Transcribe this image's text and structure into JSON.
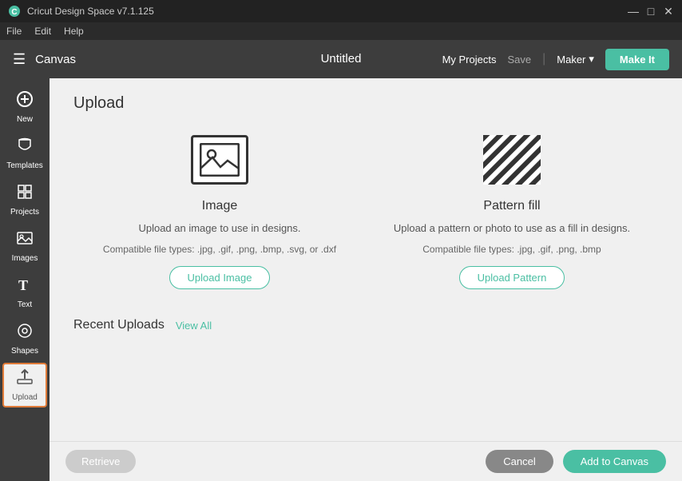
{
  "titlebar": {
    "title": "Cricut Design Space  v7.1.125",
    "minimize": "—",
    "maximize": "□",
    "close": "✕"
  },
  "menubar": {
    "items": [
      "File",
      "Edit",
      "Help"
    ]
  },
  "appbar": {
    "hamburger": "☰",
    "canvas_label": "Canvas",
    "project_title": "Untitled",
    "my_projects": "My Projects",
    "save": "Save",
    "separator": "|",
    "maker": "Maker",
    "maker_chevron": "▾",
    "make_it": "Make It"
  },
  "sidebar": {
    "items": [
      {
        "id": "new",
        "label": "New",
        "icon": "+"
      },
      {
        "id": "templates",
        "label": "Templates",
        "icon": "👕"
      },
      {
        "id": "projects",
        "label": "Projects",
        "icon": "⊞"
      },
      {
        "id": "images",
        "label": "Images",
        "icon": "🖼"
      },
      {
        "id": "text",
        "label": "Text",
        "icon": "T"
      },
      {
        "id": "shapes",
        "label": "Shapes",
        "icon": "◎"
      },
      {
        "id": "upload",
        "label": "Upload",
        "icon": "⬆",
        "active": true
      }
    ]
  },
  "content": {
    "page_title": "Upload",
    "image_card": {
      "title": "Image",
      "description": "Upload an image to use in designs.",
      "file_types": "Compatible file types: .jpg, .gif, .png, .bmp, .svg, or .dxf",
      "button_label": "Upload Image"
    },
    "pattern_card": {
      "title": "Pattern fill",
      "description": "Upload a pattern or photo to use as a fill in designs.",
      "file_types": "Compatible file types: .jpg, .gif, .png, .bmp",
      "button_label": "Upload Pattern"
    },
    "recent_uploads": {
      "title": "Recent Uploads",
      "view_all": "View All"
    }
  },
  "bottombar": {
    "retrieve_label": "Retrieve",
    "cancel_label": "Cancel",
    "add_canvas_label": "Add to Canvas"
  }
}
